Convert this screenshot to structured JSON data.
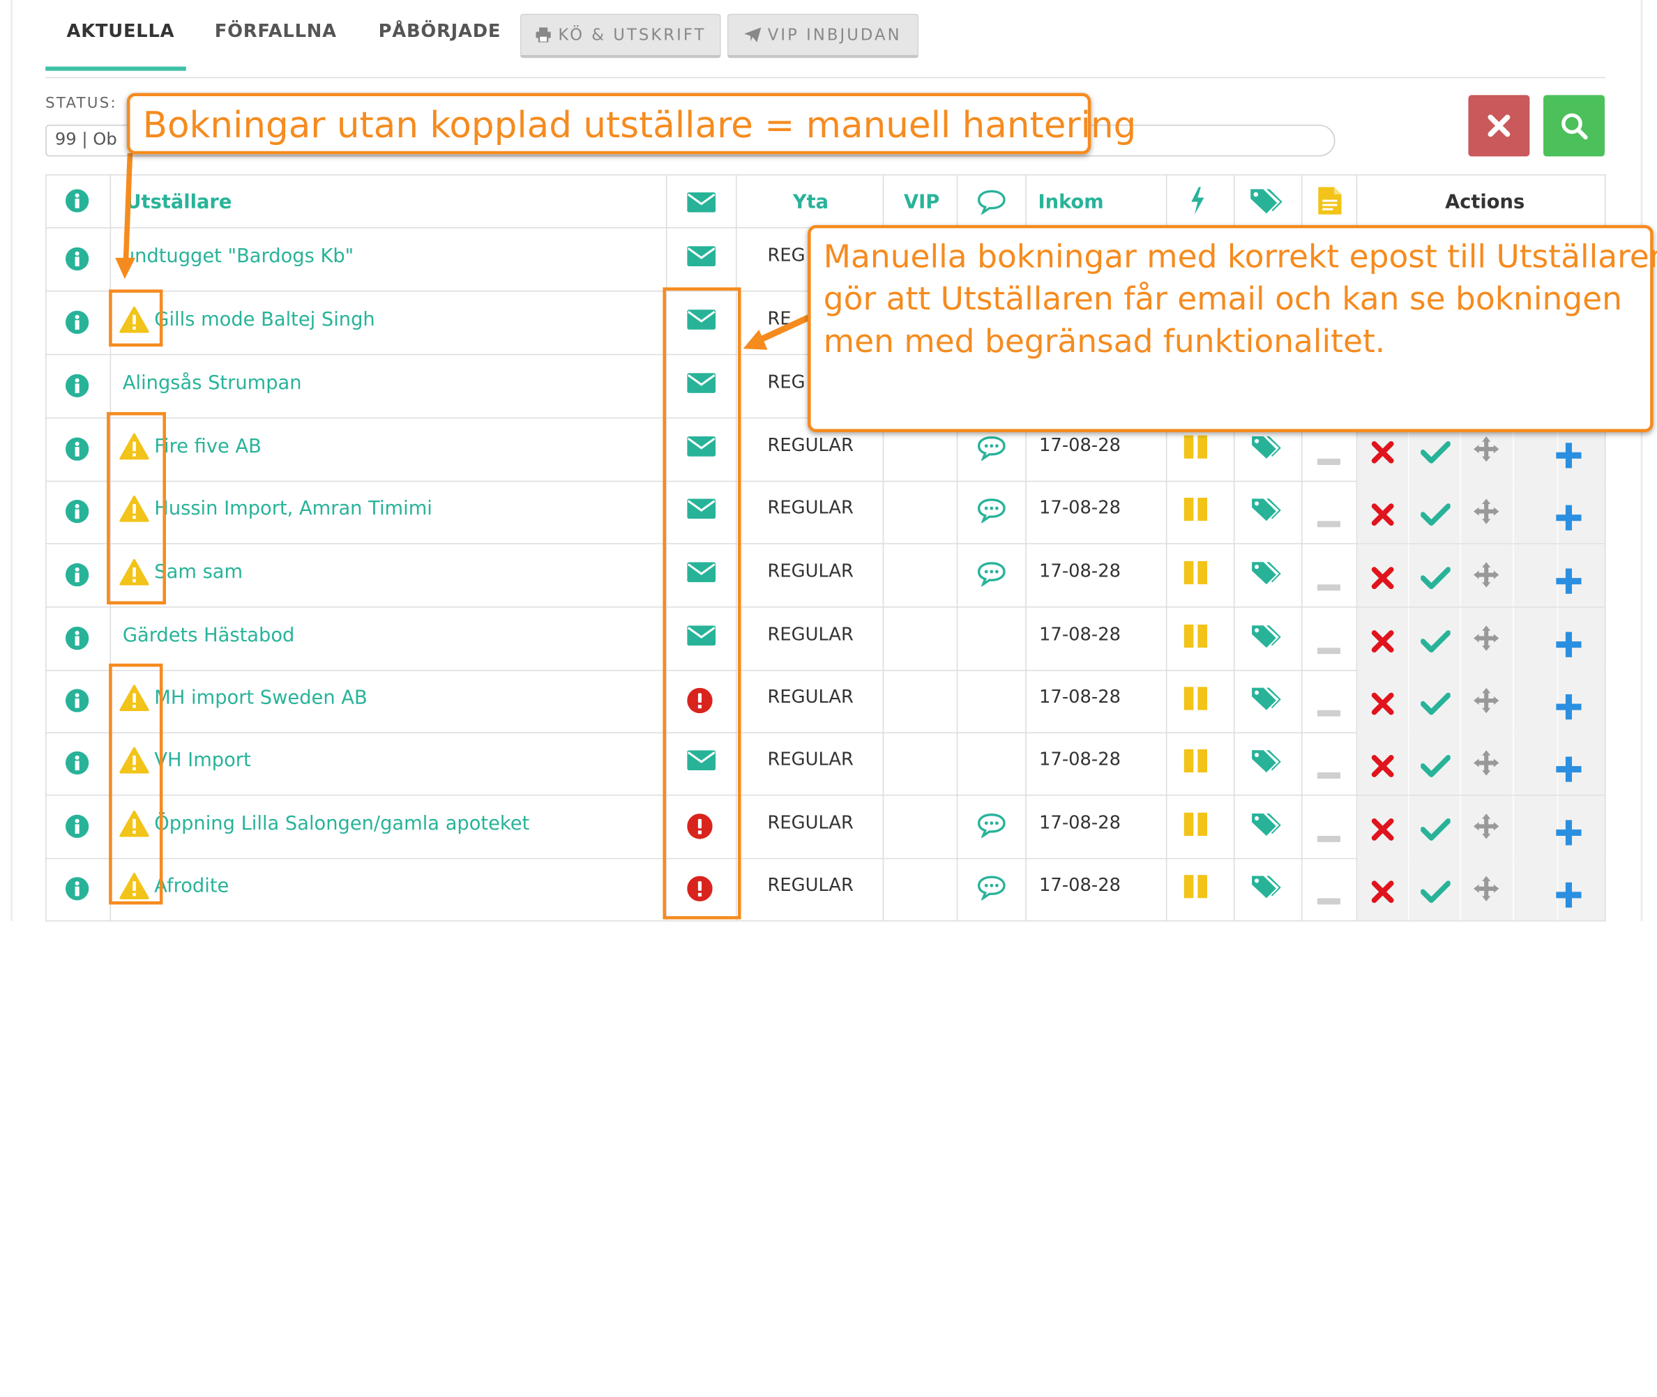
{
  "tabs": [
    {
      "label": "AKTUELLA"
    },
    {
      "label": "FÖRFALLNA"
    },
    {
      "label": "PÅBÖRJADE"
    }
  ],
  "tab_buttons": [
    {
      "label": "KÖ & UTSKRIFT",
      "icon": "print-icon"
    },
    {
      "label": "VIP INBJUDAN",
      "icon": "paper-plane-icon"
    }
  ],
  "status": {
    "label": "STATUS:",
    "value": "99 | Ob"
  },
  "table": {
    "headers": {
      "utstallare": "Utställare",
      "yta": "Yta",
      "vip": "VIP",
      "inkom": "Inkom",
      "actions": "Actions"
    },
    "rows": [
      {
        "name": "Fundtugget \"Bardogs Kb\"",
        "name_visible": "undtugget \"Bardogs Kb\"",
        "warning": false,
        "mail": "envelope-icon",
        "yta": "REG",
        "comment": false,
        "date": ""
      },
      {
        "name": "Gills mode Baltej Singh",
        "warning": true,
        "mail": "envelope-icon",
        "yta": "RE",
        "comment": false,
        "date": ""
      },
      {
        "name": "Alingsås Strumpan",
        "warning": false,
        "mail": "envelope-icon",
        "yta": "REG",
        "comment": false,
        "date": ""
      },
      {
        "name": "Fire five AB",
        "warning": true,
        "mail": "envelope-icon",
        "yta": "REGULAR",
        "comment": true,
        "date": "17-08-28"
      },
      {
        "name": "Hussin Import, Amran Timimi",
        "warning": true,
        "mail": "envelope-icon",
        "yta": "REGULAR",
        "comment": true,
        "date": "17-08-28"
      },
      {
        "name": "Sam sam",
        "warning": true,
        "mail": "envelope-icon",
        "yta": "REGULAR",
        "comment": true,
        "date": "17-08-28"
      },
      {
        "name": "Gärdets Hästabod",
        "warning": false,
        "mail": "envelope-icon",
        "yta": "REGULAR",
        "comment": false,
        "date": "17-08-28"
      },
      {
        "name": "MH import Sweden AB",
        "warning": true,
        "mail": "exclamation-circle-icon",
        "yta": "REGULAR",
        "comment": false,
        "date": "17-08-28"
      },
      {
        "name": "VH Import",
        "warning": true,
        "mail": "envelope-icon",
        "yta": "REGULAR",
        "comment": false,
        "date": "17-08-28"
      },
      {
        "name": "Öppning Lilla Salongen/gamla apoteket",
        "warning": true,
        "mail": "exclamation-circle-icon",
        "yta": "REGULAR",
        "comment": true,
        "date": "17-08-28"
      },
      {
        "name": "Afrodite",
        "warning": true,
        "mail": "exclamation-circle-icon",
        "yta": "REGULAR",
        "comment": true,
        "date": "17-08-28"
      }
    ]
  },
  "callouts": {
    "top": "Bokningar utan kopplad utställare = manuell hantering",
    "right_line1": "Manuella bokningar med korrekt epost till Utställaren",
    "right_line2": "gör att Utställaren får email och kan se bokningen",
    "right_line3": "men med begränsad funktionalitet."
  },
  "colors": {
    "accent": "#28b399",
    "warning": "#f2c318",
    "danger": "#d9231d",
    "callout": "#f58b1f",
    "clear_button": "#c9595a",
    "search_button": "#4cc05a"
  }
}
